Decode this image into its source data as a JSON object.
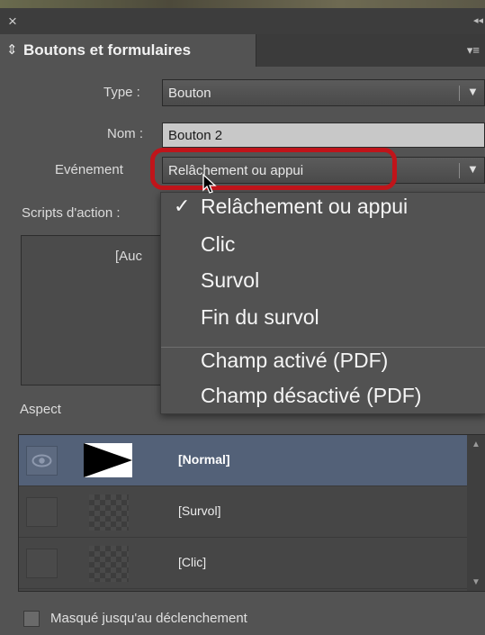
{
  "window": {
    "close_glyph": "×",
    "collapse_glyph": "◂◂"
  },
  "panel": {
    "title": "Boutons et formulaires",
    "title_icon": "⇕",
    "menu_glyph": "▾≡"
  },
  "fields": {
    "type_label": "Type :",
    "type_value": "Bouton",
    "name_label": "Nom :",
    "name_value": "Bouton 2",
    "event_label": "Evénement",
    "event_value": "Relâchement ou appui",
    "scripts_label": "Scripts d'action :",
    "action_placeholder": "[Auc"
  },
  "event_menu": {
    "checkmark": "✓",
    "items": [
      {
        "label": "Relâchement ou appui",
        "checked": true
      },
      {
        "label": "Clic",
        "checked": false
      },
      {
        "label": "Survol",
        "checked": false
      },
      {
        "label": "Fin du survol",
        "checked": false
      },
      {
        "label": "Champ activé (PDF)",
        "checked": false
      },
      {
        "label": "Champ désactivé (PDF)",
        "checked": false
      }
    ]
  },
  "aspect": {
    "label": "Aspect",
    "states": [
      {
        "label": "[Normal]",
        "selected": true
      },
      {
        "label": "[Survol]",
        "selected": false
      },
      {
        "label": "[Clic]",
        "selected": false
      }
    ]
  },
  "footer": {
    "hide_until_trigger_label": "Masqué jusqu'au déclenchement",
    "checked": false
  },
  "colors": {
    "panel_bg": "#535353",
    "highlight": "#c0141a",
    "selected_row": "#536178"
  }
}
